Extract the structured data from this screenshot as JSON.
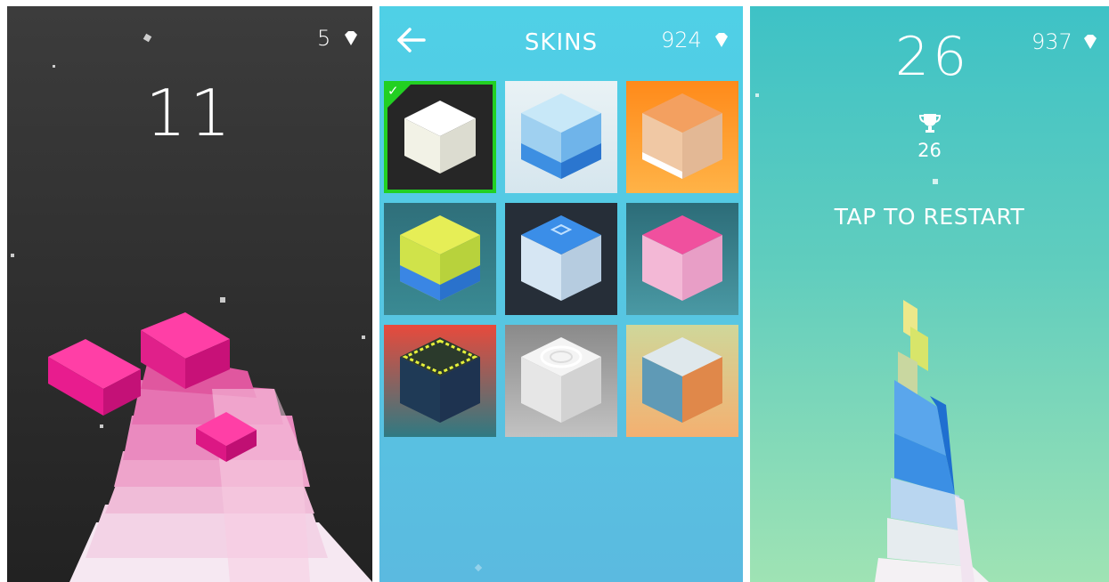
{
  "game_screen": {
    "score": "11",
    "gems": "5",
    "gem_icon": "diamond-icon"
  },
  "skins_screen": {
    "title": "SKINS",
    "gems": "924",
    "back_icon": "arrow-left-icon",
    "gem_icon": "diamond-icon",
    "skins": [
      {
        "name": "plain-white",
        "selected": true
      },
      {
        "name": "blue-striped",
        "selected": false
      },
      {
        "name": "orange-brick",
        "selected": false
      },
      {
        "name": "yellow-blue-layered",
        "selected": false
      },
      {
        "name": "blue-tile",
        "selected": false
      },
      {
        "name": "pink-pattern",
        "selected": false
      },
      {
        "name": "grid-neon",
        "selected": false
      },
      {
        "name": "white-rings",
        "selected": false
      },
      {
        "name": "orange-mesh",
        "selected": false
      }
    ]
  },
  "gameover_screen": {
    "score": "26",
    "gems": "937",
    "best_label_icon": "trophy-icon",
    "best": "26",
    "restart_label": "TAP TO RESTART",
    "gem_icon": "diamond-icon"
  },
  "colors": {
    "pink": "#ec1c8c",
    "skins_bg": "#55c8e4",
    "gameover_bg_top": "#3ec2c6",
    "gameover_bg_bottom": "#9fe3b4",
    "selected_outline": "#22d022"
  }
}
